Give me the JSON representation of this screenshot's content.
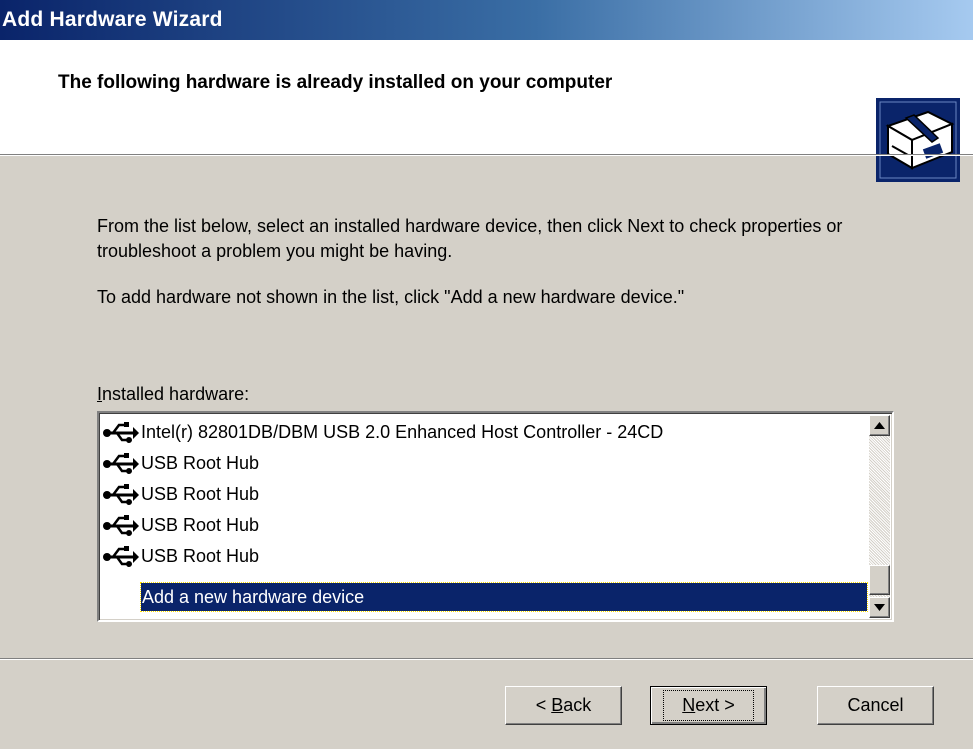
{
  "window": {
    "title": "Add Hardware Wizard"
  },
  "header": {
    "title": "The following hardware is already installed on your computer",
    "icon": "hardware-wizard-icon"
  },
  "body": {
    "instruction_line1": "From the list below, select an installed hardware device, then click Next to check properties or troubleshoot a problem you might be having.",
    "instruction_line2": "To add hardware not shown in the list, click \"Add a new hardware device.\""
  },
  "list": {
    "label_prefix": "I",
    "label_rest": "nstalled hardware:",
    "items": [
      {
        "label": "Intel(r) 82801DB/DBM USB 2.0 Enhanced Host Controller - 24CD",
        "icon": "usb-icon"
      },
      {
        "label": "USB Root Hub",
        "icon": "usb-icon"
      },
      {
        "label": "USB Root Hub",
        "icon": "usb-icon"
      },
      {
        "label": "USB Root Hub",
        "icon": "usb-icon"
      },
      {
        "label": "USB Root Hub",
        "icon": "usb-icon"
      },
      {
        "label": "Add a new hardware device",
        "selected": true
      }
    ]
  },
  "buttons": {
    "back_pre": "< ",
    "back_key": "B",
    "back_rest": "ack",
    "next_key": "N",
    "next_rest": "ext >",
    "cancel": "Cancel"
  },
  "colors": {
    "selection": "#0a246a",
    "dialog": "#d4d0c8"
  }
}
